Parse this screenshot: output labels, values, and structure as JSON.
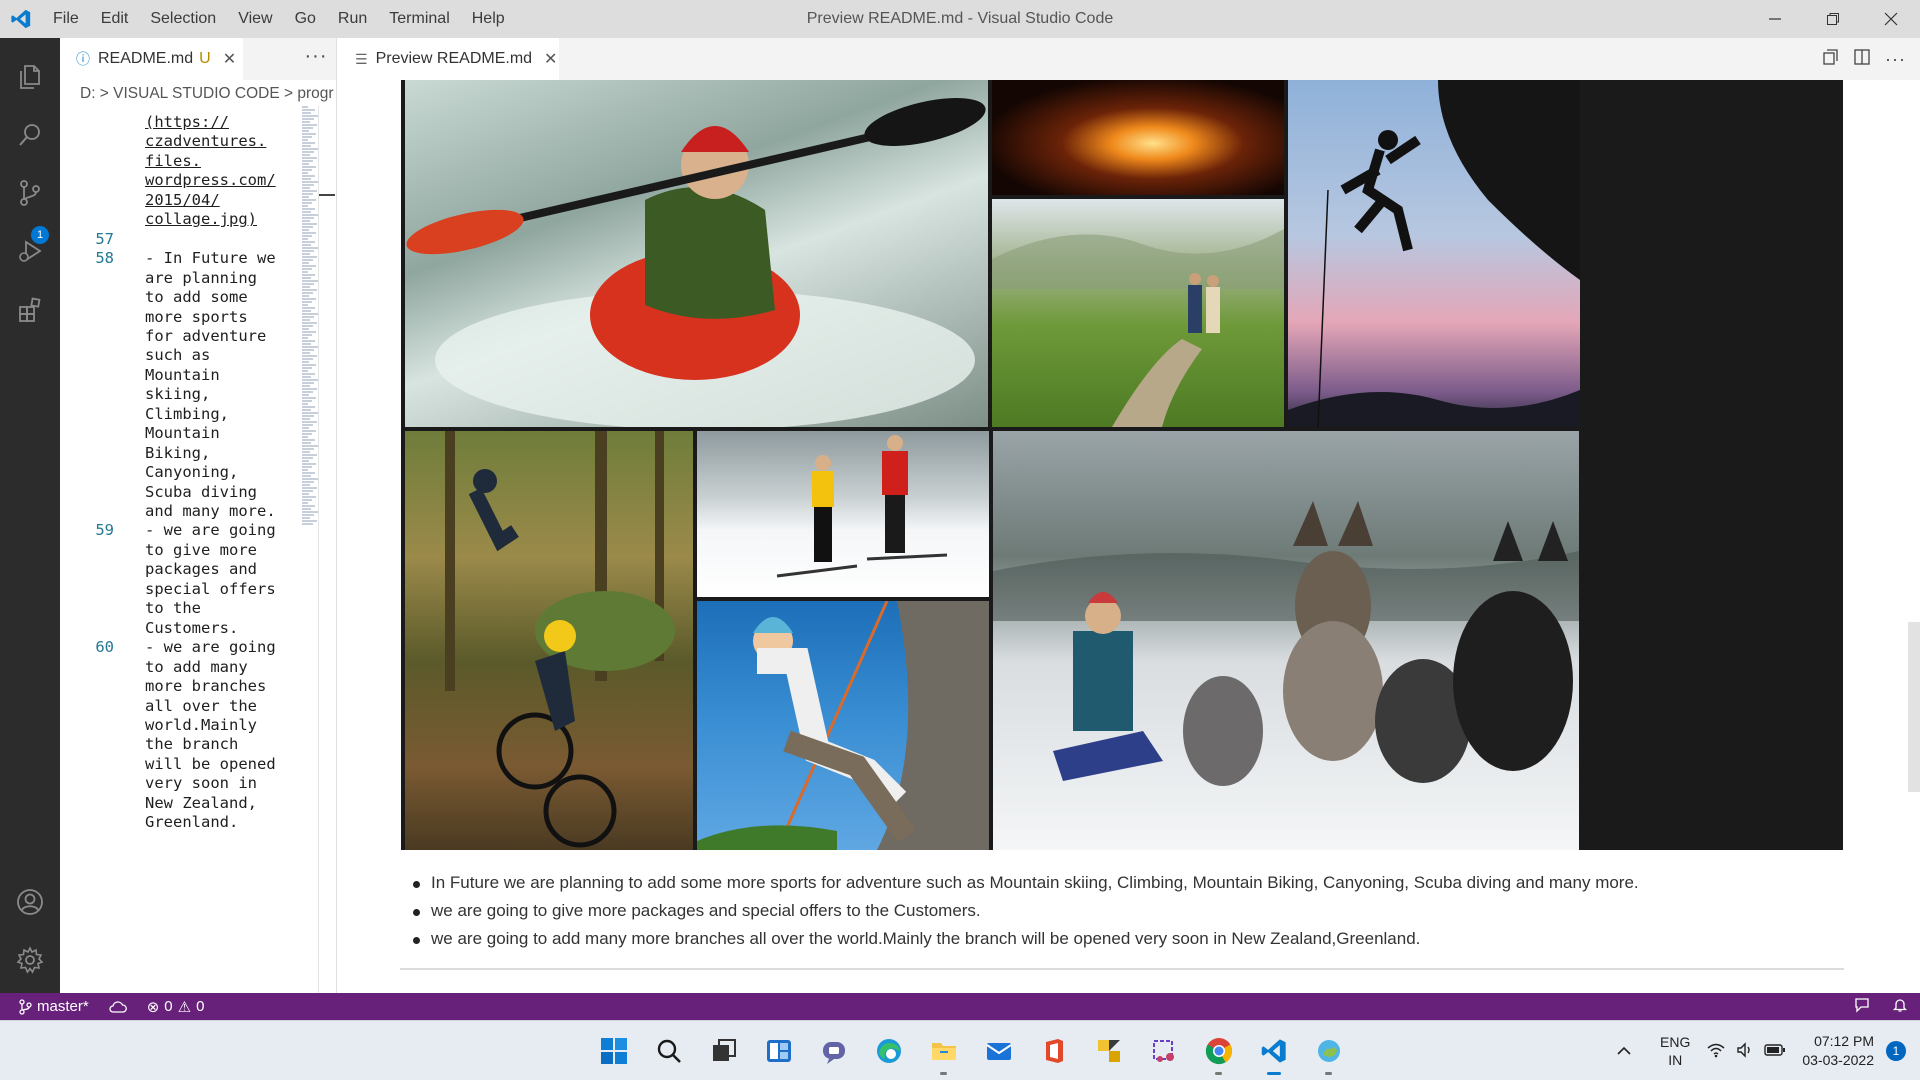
{
  "titlebar": {
    "menu": [
      "File",
      "Edit",
      "Selection",
      "View",
      "Go",
      "Run",
      "Terminal",
      "Help"
    ],
    "window_title": "Preview README.md - Visual Studio Code"
  },
  "activitybar": {
    "icons": [
      "explorer-icon",
      "search-icon",
      "source-control-icon",
      "run-debug-icon",
      "extensions-icon",
      "account-icon",
      "settings-gear-icon"
    ],
    "source_control_badge": "1"
  },
  "left_editor": {
    "tab": {
      "label": "README.md",
      "status": "U"
    },
    "more_actions": "···",
    "breadcrumb": "D: > VISUAL STUDIO CODE > progr",
    "lines": [
      {
        "ln": "",
        "text": "(https://",
        "link": true
      },
      {
        "ln": "",
        "text": "czadventures.",
        "link": true
      },
      {
        "ln": "",
        "text": "files.",
        "link": true
      },
      {
        "ln": "",
        "text": "wordpress.com/",
        "link": true
      },
      {
        "ln": "",
        "text": "2015/04/",
        "link": true
      },
      {
        "ln": "",
        "text": "collage.jpg)",
        "link": true
      },
      {
        "ln": "57",
        "text": "",
        "link": false
      },
      {
        "ln": "58",
        "text": "- In Future we",
        "link": false
      },
      {
        "ln": "",
        "text": "are planning",
        "link": false
      },
      {
        "ln": "",
        "text": "to add some",
        "link": false
      },
      {
        "ln": "",
        "text": "more sports",
        "link": false
      },
      {
        "ln": "",
        "text": "for adventure",
        "link": false
      },
      {
        "ln": "",
        "text": "such as",
        "link": false
      },
      {
        "ln": "",
        "text": "Mountain",
        "link": false
      },
      {
        "ln": "",
        "text": "skiing,",
        "link": false
      },
      {
        "ln": "",
        "text": "Climbing,",
        "link": false
      },
      {
        "ln": "",
        "text": "Mountain",
        "link": false
      },
      {
        "ln": "",
        "text": "Biking,",
        "link": false
      },
      {
        "ln": "",
        "text": "Canyoning,",
        "link": false
      },
      {
        "ln": "",
        "text": "Scuba diving",
        "link": false
      },
      {
        "ln": "",
        "text": "and many more.",
        "link": false
      },
      {
        "ln": "59",
        "text": "- we are going",
        "link": false
      },
      {
        "ln": "",
        "text": "to give more",
        "link": false
      },
      {
        "ln": "",
        "text": "packages and",
        "link": false
      },
      {
        "ln": "",
        "text": "special offers",
        "link": false
      },
      {
        "ln": "",
        "text": "to the",
        "link": false
      },
      {
        "ln": "",
        "text": "Customers.",
        "link": false
      },
      {
        "ln": "60",
        "text": "- we are going",
        "link": false
      },
      {
        "ln": "",
        "text": "to add many",
        "link": false
      },
      {
        "ln": "",
        "text": "more branches",
        "link": false
      },
      {
        "ln": "",
        "text": "all over the",
        "link": false
      },
      {
        "ln": "",
        "text": "world.Mainly",
        "link": false
      },
      {
        "ln": "",
        "text": "the branch",
        "link": false
      },
      {
        "ln": "",
        "text": "will be opened",
        "link": false
      },
      {
        "ln": "",
        "text": "very soon in",
        "link": false
      },
      {
        "ln": "",
        "text": "New Zealand,",
        "link": false
      },
      {
        "ln": "",
        "text": "Greenland.",
        "link": false
      }
    ]
  },
  "right_editor": {
    "tab": {
      "label": "Preview README.md"
    },
    "actions": [
      "open-source-icon",
      "split-editor-icon",
      "more-actions-icon"
    ],
    "collage_photos": [
      "kayaking",
      "campfire",
      "rock-climbing",
      "hiking",
      "mountain-biking",
      "cross-country-skiing",
      "dog-sledding",
      "rope-climbing"
    ],
    "bullets": [
      "In Future we are planning to add some more sports for adventure such as Mountain skiing, Climbing, Mountain Biking, Canyoning, Scuba diving and many more.",
      "we are going to give more packages and special offers to the Customers.",
      "we are going to add many more branches all over the world.Mainly the branch will be opened very soon in New Zealand,Greenland."
    ]
  },
  "statusbar": {
    "branch": "master*",
    "errors": "0",
    "warnings": "0",
    "color": "#68217a"
  },
  "taskbar": {
    "apps": [
      "start-icon",
      "search-icon",
      "task-view-icon",
      "widgets-icon",
      "teams-chat-icon",
      "edge-icon",
      "file-explorer-icon",
      "mail-icon",
      "office-icon",
      "sticky-app-icon",
      "snipping-tool-icon",
      "chrome-icon",
      "vscode-icon",
      "weather-app-icon"
    ],
    "lang_top": "ENG",
    "lang_bottom": "IN",
    "time": "07:12 PM",
    "date": "03-03-2022",
    "notifications": "1"
  }
}
